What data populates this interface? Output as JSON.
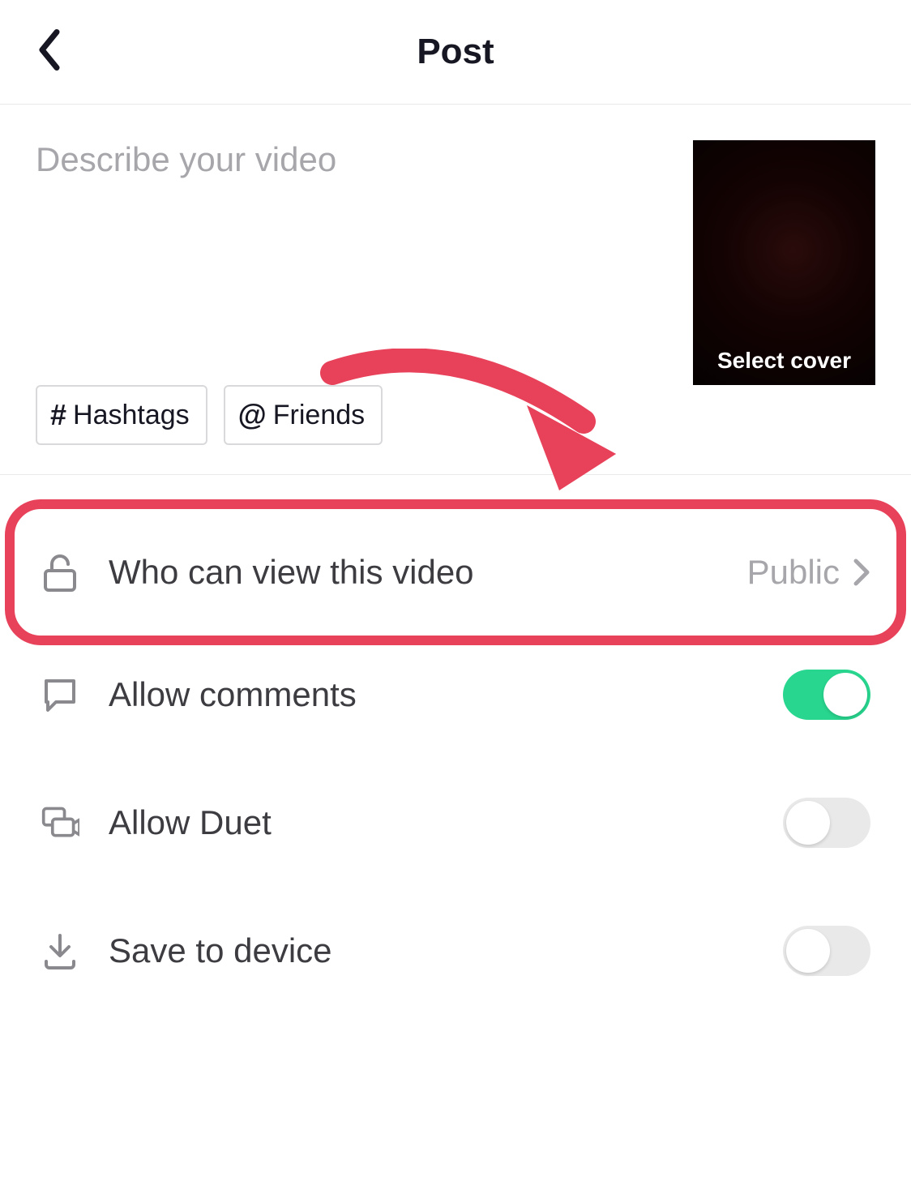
{
  "header": {
    "title": "Post"
  },
  "compose": {
    "caption_placeholder": "Describe your video",
    "hashtags_label": "Hashtags",
    "friends_label": "Friends",
    "select_cover_label": "Select cover"
  },
  "settings": {
    "privacy": {
      "label": "Who can view this video",
      "value": "Public"
    },
    "comments": {
      "label": "Allow comments",
      "on": true
    },
    "duet": {
      "label": "Allow Duet",
      "on": false
    },
    "save": {
      "label": "Save to device",
      "on": false
    }
  },
  "annotation": {
    "highlight_row": "privacy",
    "arrow_target": "privacy-value"
  }
}
